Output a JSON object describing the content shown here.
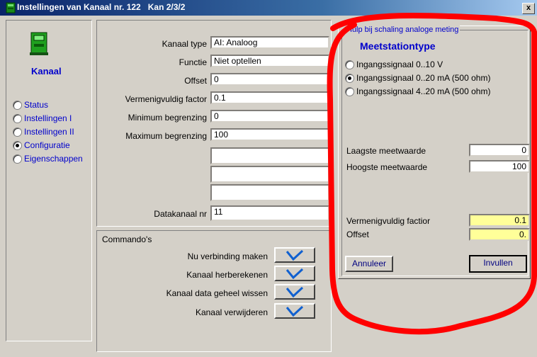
{
  "window": {
    "title": "Instellingen van Kanaal nr. 122",
    "subtitle": "Kan 2/3/2",
    "close_label": "x"
  },
  "sidebar": {
    "heading": "Kanaal",
    "items": [
      {
        "label": "Status",
        "selected": false
      },
      {
        "label": "Instellingen I",
        "selected": false
      },
      {
        "label": "Instellingen II",
        "selected": false
      },
      {
        "label": "Configuratie",
        "selected": true
      },
      {
        "label": "Eigenschappen",
        "selected": false
      }
    ]
  },
  "form": {
    "kanaal_type": {
      "label": "Kanaal type",
      "value": "AI: Analoog"
    },
    "functie": {
      "label": "Functie",
      "value": "Niet optellen"
    },
    "offset": {
      "label": "Offset",
      "value": "0"
    },
    "vermenigvuldig": {
      "label": "Vermenigvuldig factor",
      "value": "0.1"
    },
    "minimum": {
      "label": "Minimum begrenzing",
      "value": "0"
    },
    "maximum": {
      "label": "Maximum begrenzing",
      "value": "100"
    },
    "extra1": {
      "value": ""
    },
    "extra2": {
      "value": ""
    },
    "extra3": {
      "value": ""
    },
    "datakanaal": {
      "label": "Datakanaal nr",
      "value": "11"
    }
  },
  "commands": {
    "group_label": "Commando's",
    "items": [
      {
        "label": "Nu verbinding maken"
      },
      {
        "label": "Kanaal herberekenen"
      },
      {
        "label": "Kanaal data geheel wissen"
      },
      {
        "label": "Kanaal verwijderen"
      }
    ]
  },
  "helper": {
    "group_label": "Hulp bij schaling analoge meting",
    "title": "Meetstationtype",
    "options": [
      {
        "label": "Ingangssignaal 0..10 V",
        "selected": false
      },
      {
        "label": "Ingangssignaal 0..20 mA (500 ohm)",
        "selected": true
      },
      {
        "label": "Ingangssignaal 4..20 mA (500 ohm)",
        "selected": false
      }
    ],
    "laagste": {
      "label": "Laagste meetwaarde",
      "value": "0"
    },
    "hoogste": {
      "label": "Hoogste meetwaarde",
      "value": "100"
    },
    "factor": {
      "label": "Vermenigvuldig factior",
      "value": "0.1"
    },
    "offset": {
      "label": "Offset",
      "value": "0."
    },
    "cancel_label": "Annuleer",
    "fill_label": "Invullen"
  },
  "colors": {
    "accent_blue": "#0000cc",
    "highlight_yellow": "#ffff99",
    "annotation_red": "#ff0000"
  }
}
